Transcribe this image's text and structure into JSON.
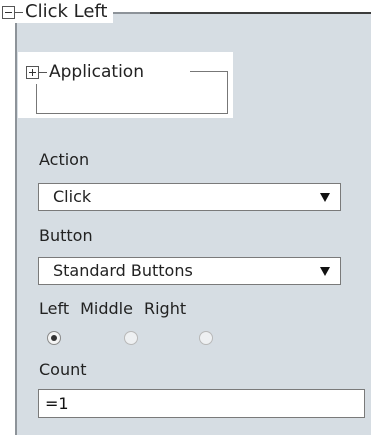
{
  "group": {
    "title": "Click Left",
    "toggle_icon": "collapse-minus-icon"
  },
  "application": {
    "title": "Application",
    "toggle_icon": "expand-plus-icon"
  },
  "action": {
    "label": "Action",
    "selected": "Click"
  },
  "button": {
    "label": "Button",
    "selected": "Standard Buttons",
    "options": [
      {
        "label": "Left",
        "checked": true
      },
      {
        "label": "Middle",
        "checked": false
      },
      {
        "label": "Right",
        "checked": false
      }
    ]
  },
  "count": {
    "label": "Count",
    "value": "=1"
  },
  "colors": {
    "panel_bg": "#d6dde3",
    "border": "#8d9399"
  }
}
